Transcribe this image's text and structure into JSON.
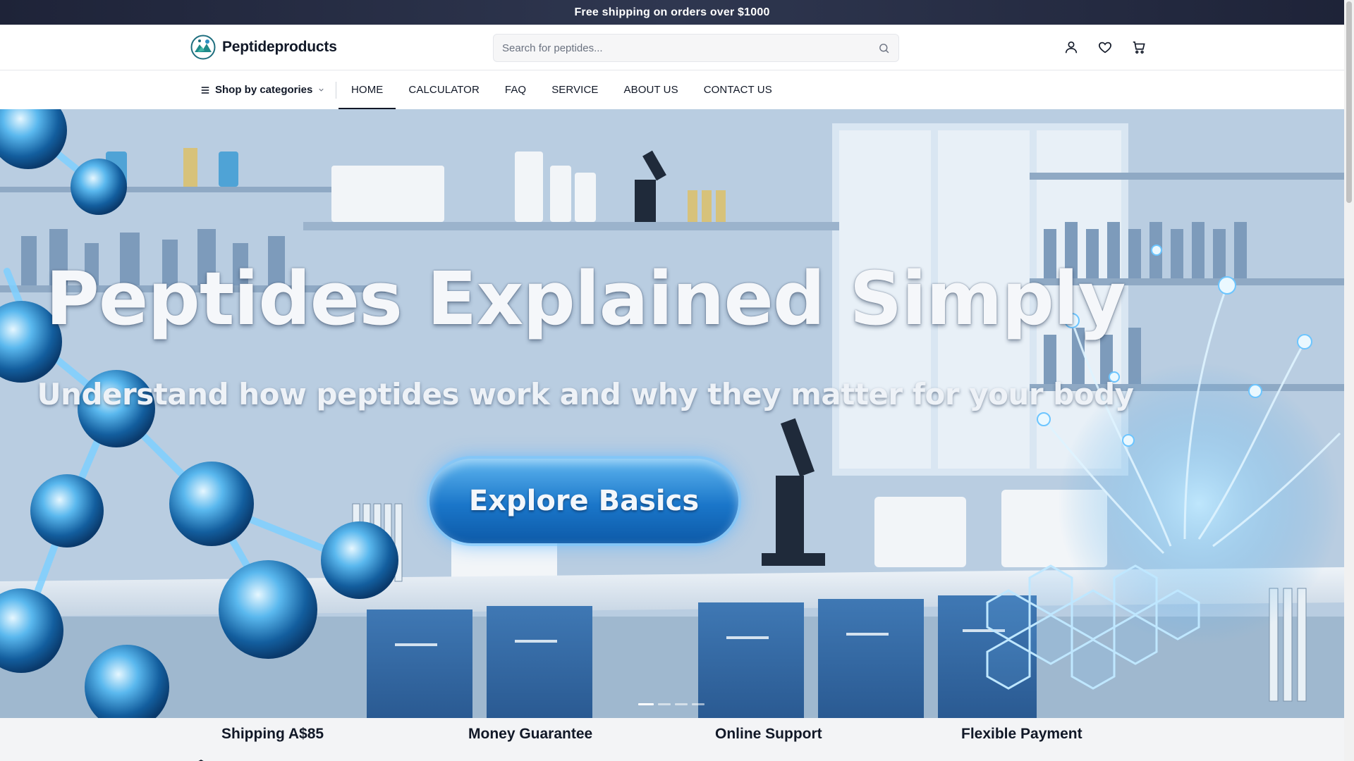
{
  "announcement": {
    "text": "Free shipping on orders over $1000"
  },
  "header": {
    "logo_text": "Peptideproducts",
    "search_placeholder": "Search for peptides...",
    "icons": [
      "user-icon",
      "heart-icon",
      "cart-icon"
    ]
  },
  "nav": {
    "categories_label": "Shop by categories",
    "links": [
      {
        "label": "HOME",
        "active": true
      },
      {
        "label": "CALCULATOR",
        "active": false
      },
      {
        "label": "FAQ",
        "active": false
      },
      {
        "label": "SERVICE",
        "active": false
      },
      {
        "label": "ABOUT US",
        "active": false
      },
      {
        "label": "CONTACT US",
        "active": false
      }
    ]
  },
  "hero": {
    "title": "Peptides Explained Simply",
    "subtitle": "Understand how peptides work and why they matter for your body",
    "cta_label": "Explore Basics",
    "slides_count": 4,
    "active_slide": 1
  },
  "features": [
    {
      "title": "Shipping A$85",
      "icon": "box-icon"
    },
    {
      "title": "Money Guarantee",
      "icon": "badge-check-icon"
    },
    {
      "title": "Online Support",
      "icon": "headphones-icon"
    },
    {
      "title": "Flexible Payment",
      "icon": "credit-card-icon"
    }
  ],
  "colors": {
    "announcement_bg": "#2a3147",
    "text_dark": "#111827",
    "cta_blue": "#1a76c9",
    "features_bg": "#f3f4f6"
  }
}
